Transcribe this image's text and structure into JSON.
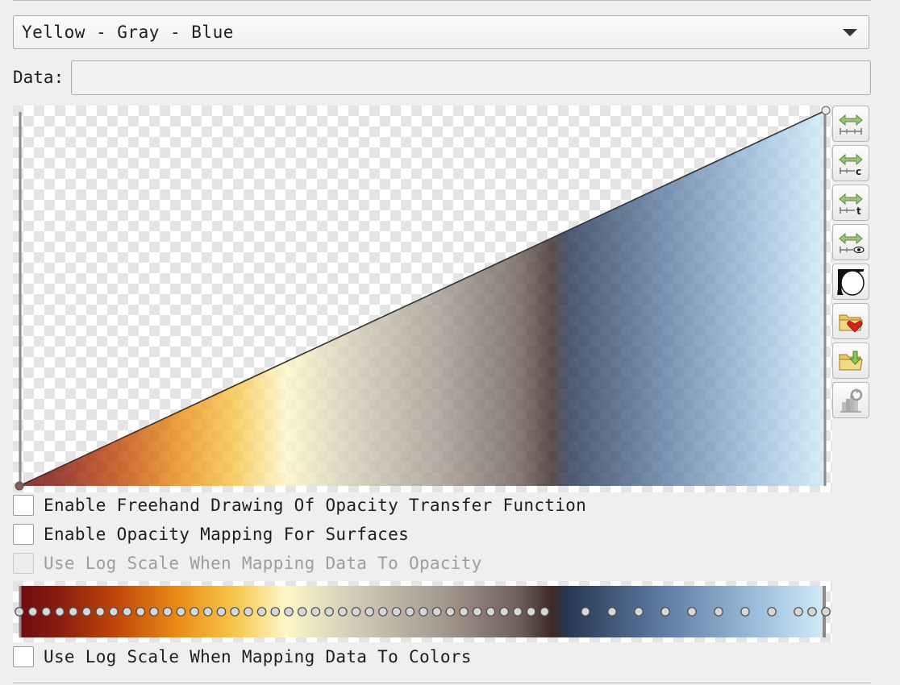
{
  "preset": {
    "selected": "Yellow - Gray - Blue"
  },
  "data_field": {
    "label": "Data:",
    "value": ""
  },
  "opacity_editor": {
    "points": [
      {
        "x": 0.0,
        "opacity": 0.0
      },
      {
        "x": 1.0,
        "opacity": 1.0
      }
    ]
  },
  "color_editor": {
    "stops": [
      {
        "pos": 0.0,
        "color": "#6e0c10"
      },
      {
        "pos": 0.05,
        "color": "#8a1d10"
      },
      {
        "pos": 0.12,
        "color": "#c0460a"
      },
      {
        "pos": 0.2,
        "color": "#ec8f18"
      },
      {
        "pos": 0.27,
        "color": "#f7c84e"
      },
      {
        "pos": 0.33,
        "color": "#fdf7c8"
      },
      {
        "pos": 0.41,
        "color": "#d5cdb8"
      },
      {
        "pos": 0.52,
        "color": "#a79c92"
      },
      {
        "pos": 0.62,
        "color": "#6e5f59"
      },
      {
        "pos": 0.66,
        "color": "#3e2a28"
      },
      {
        "pos": 0.68,
        "color": "#283854"
      },
      {
        "pos": 0.8,
        "color": "#5f7da3"
      },
      {
        "pos": 0.92,
        "color": "#9fc0de"
      },
      {
        "pos": 1.0,
        "color": "#d3ebf7"
      }
    ]
  },
  "checkboxes": {
    "freehand": {
      "label": "Enable Freehand Drawing Of Opacity Transfer Function",
      "checked": false,
      "enabled": true
    },
    "surfaces": {
      "label": "Enable Opacity Mapping For Surfaces",
      "checked": false,
      "enabled": true
    },
    "log_opacity": {
      "label": "Use Log Scale When Mapping Data To Opacity",
      "checked": false,
      "enabled": false
    },
    "log_colors": {
      "label": "Use Log Scale When Mapping Data To Colors",
      "checked": false,
      "enabled": true
    }
  },
  "toolbar": {
    "buttons": [
      {
        "icon": "rescale-to-data-range-icon"
      },
      {
        "icon": "rescale-to-custom-range-icon"
      },
      {
        "icon": "rescale-to-temporal-range-icon"
      },
      {
        "icon": "rescale-to-visible-range-icon"
      },
      {
        "icon": "invert-transfer-function-icon"
      },
      {
        "icon": "choose-preset-icon"
      },
      {
        "icon": "save-to-preset-icon"
      },
      {
        "icon": "data-histogram-icon"
      }
    ]
  }
}
